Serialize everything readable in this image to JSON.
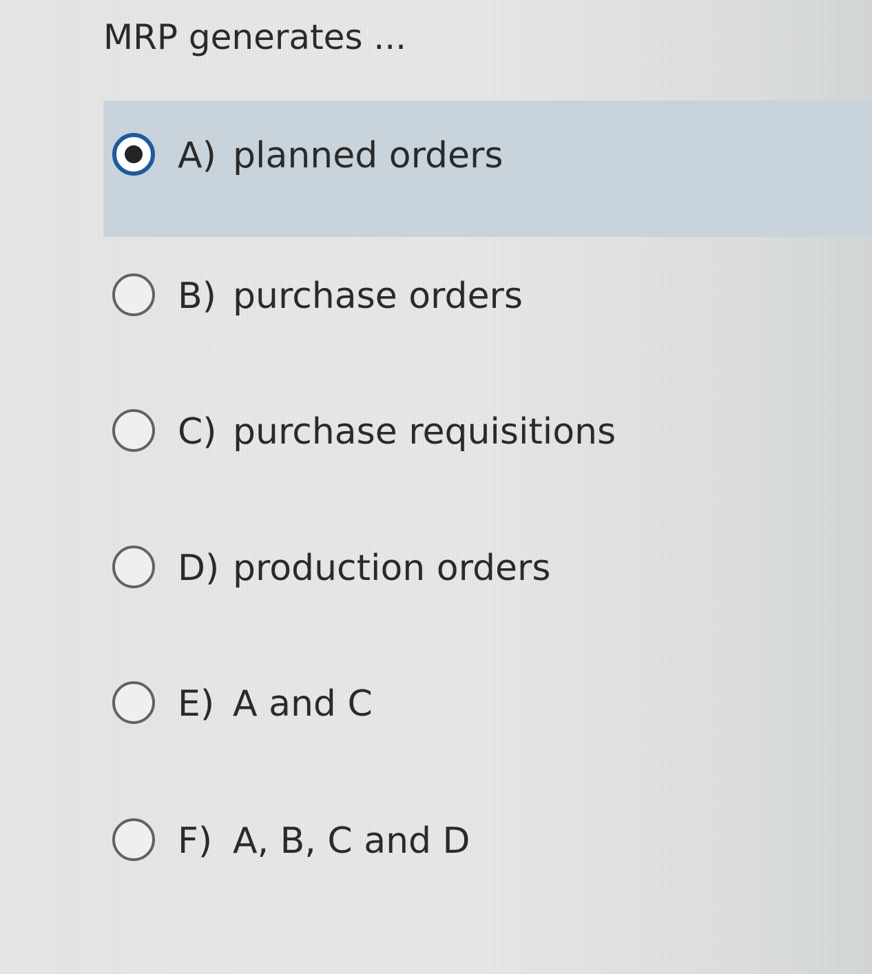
{
  "question": {
    "text": "MRP generates ..."
  },
  "options": [
    {
      "letter": "A)",
      "text": "planned orders",
      "selected": true
    },
    {
      "letter": "B)",
      "text": "purchase orders",
      "selected": false
    },
    {
      "letter": "C)",
      "text": "purchase requisitions",
      "selected": false
    },
    {
      "letter": "D)",
      "text": "production orders",
      "selected": false
    },
    {
      "letter": "E)",
      "text": "A and C",
      "selected": false
    },
    {
      "letter": "F)",
      "text": "A, B, C and D",
      "selected": false
    }
  ],
  "colors": {
    "selected_background": "#c9d3dc",
    "radio_checked_ring": "#1f5a9d",
    "radio_unchecked_ring": "#5f6366",
    "text": "#2a2a2a"
  }
}
